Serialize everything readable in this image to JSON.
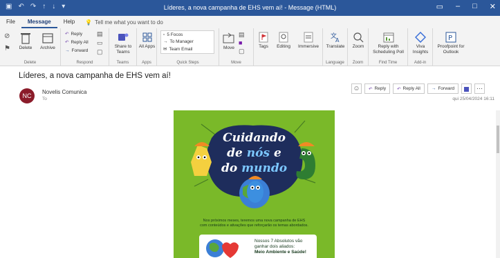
{
  "window": {
    "title": "Líderes, a nova campanha de EHS vem aí!  -  Message (HTML)"
  },
  "menu": {
    "tabs": [
      "File",
      "Message",
      "Help"
    ],
    "tell_me": "Tell me what you want to do"
  },
  "ribbon": {
    "delete": {
      "label": "Delete",
      "archive": "Archive",
      "group": "Delete"
    },
    "respond": {
      "reply": "Reply",
      "reply_all": "Reply All",
      "forward": "Forward",
      "group": "Respond"
    },
    "teams": {
      "share": "Share to Teams",
      "group": "Teams"
    },
    "apps": {
      "all_apps": "All Apps",
      "group": "Apps"
    },
    "quick_steps": {
      "items": [
        "5 Focos",
        "To Manager",
        "Team Email"
      ],
      "group": "Quick Steps"
    },
    "move": {
      "label": "Move",
      "group": "Move"
    },
    "tags": {
      "label": "Tags"
    },
    "editing": {
      "label": "Editing"
    },
    "immersive": {
      "label": "Immersive"
    },
    "language": {
      "translate": "Translate",
      "group": "Language"
    },
    "zoom": {
      "label": "Zoom",
      "group": "Zoom"
    },
    "find_time": {
      "label": "Reply with Scheduling Poll",
      "group": "Find Time"
    },
    "addin": {
      "viva": "Viva Insights",
      "group": "Add-in"
    },
    "proofpoint": {
      "label": "Proofpoint for Outlook"
    }
  },
  "message": {
    "subject": "Líderes, a nova campanha de EHS vem aí!",
    "avatar_initials": "NC",
    "sender": "Novelis Comunica",
    "to": "To",
    "date": "qui 25/04/2024 16:11",
    "actions": {
      "reply": "Reply",
      "reply_all": "Reply All",
      "forward": "Forward"
    }
  },
  "banner": {
    "line1": "Cuidando",
    "line2a": "de",
    "line2b": "nós",
    "line2c": "e",
    "line3a": "do",
    "line3b": "mundo",
    "body_line1": "Nos próximos meses, teremos uma nova campanha de EHS",
    "body_line2": "com conteúdos e ativações que reforçarão os temas abordados.",
    "card_line1": "Nossos 7 Absolutos vão",
    "card_line2": "ganhar dois aliados:",
    "card_line3": "Meio Ambiente e Saúde!"
  },
  "colors": {
    "titlebar": "#2b579a",
    "banner_green": "#7ab929",
    "avatar": "#8b1c2a"
  }
}
